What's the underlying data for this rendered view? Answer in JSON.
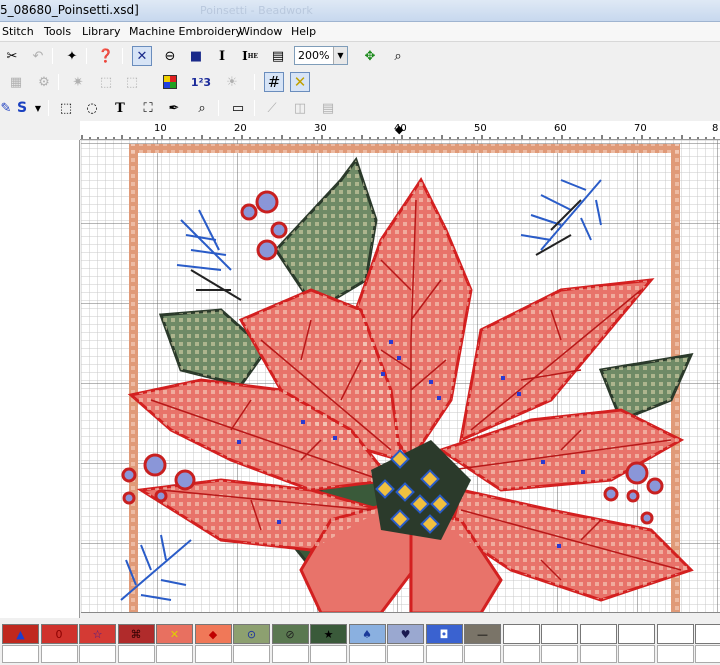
{
  "window": {
    "title": "5_08680_Poinsetti.xsd]",
    "faded_title": "Poinsetti - Beadwork"
  },
  "menu": [
    "Stitch",
    "Tools",
    "Library",
    "Machine Embroidery",
    "Window",
    "Help"
  ],
  "toolbar": {
    "zoom_value": "200%",
    "font_i_label": "I",
    "font_i_sub": "HE",
    "font_i2_label": "I",
    "text_tool": "T",
    "s_label": "S",
    "numbers_label": "1²3"
  },
  "ruler": {
    "labels": [
      "10",
      "20",
      "30",
      "40",
      "50",
      "60",
      "70",
      "8"
    ]
  },
  "palette": {
    "swatches": [
      {
        "color": "#c0281e",
        "symbol": "▲",
        "symbol_color": "#1a3fd0"
      },
      {
        "color": "#d0322c",
        "symbol": "0",
        "symbol_color": "#8a0000"
      },
      {
        "color": "#d43a34",
        "symbol": "☆",
        "symbol_color": "#3a1a9a"
      },
      {
        "color": "#b02b2b",
        "symbol": "⌘",
        "symbol_color": "#300000"
      },
      {
        "color": "#e87060",
        "symbol": "✕",
        "symbol_color": "#e0d000"
      },
      {
        "color": "#f07858",
        "symbol": "◆",
        "symbol_color": "#c00000"
      },
      {
        "color": "#8da070",
        "symbol": "⊙",
        "symbol_color": "#1a2fa0"
      },
      {
        "color": "#5a7850",
        "symbol": "⊘",
        "symbol_color": "#202020"
      },
      {
        "color": "#3a5a3a",
        "symbol": "★",
        "symbol_color": "#000000"
      },
      {
        "color": "#8ab0e0",
        "symbol": "♠",
        "symbol_color": "#1a3a9a"
      },
      {
        "color": "#9aa8d0",
        "symbol": "♥",
        "symbol_color": "#1a1a50"
      },
      {
        "color": "#3a62d0",
        "symbol": "◘",
        "symbol_color": "#ffffff"
      },
      {
        "color": "#7a7468",
        "symbol": "—",
        "symbol_color": "#000000"
      },
      {
        "color": "#ffffff",
        "symbol": "",
        "symbol_color": "#000"
      },
      {
        "color": "#ffffff",
        "symbol": "",
        "symbol_color": "#000"
      },
      {
        "color": "#ffffff",
        "symbol": "",
        "symbol_color": "#000"
      },
      {
        "color": "#ffffff",
        "symbol": "",
        "symbol_color": "#000"
      },
      {
        "color": "#ffffff",
        "symbol": "",
        "symbol_color": "#000"
      },
      {
        "color": "#ffffff",
        "symbol": "",
        "symbol_color": "#000"
      }
    ]
  },
  "colors": {
    "border_frame": "#e09a78",
    "petal": "#e8736a",
    "petal_outline": "#d32020",
    "leaf": "#6f8a66",
    "leaf_outline": "#2b3a2b",
    "vein_blue": "#2a5cc8",
    "berry": "#c82020",
    "grid_minor": "#c8c8c8",
    "grid_major": "#6c6c6c"
  }
}
